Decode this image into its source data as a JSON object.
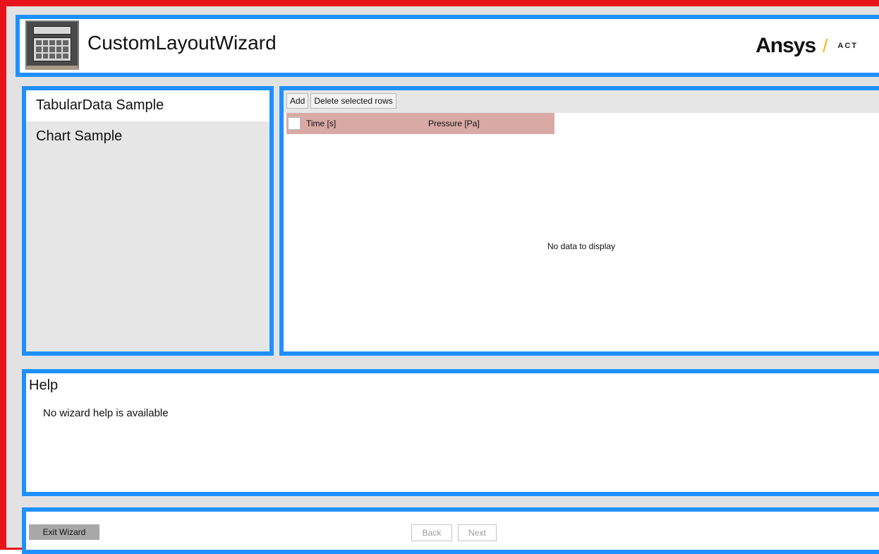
{
  "header": {
    "title": "CustomLayoutWizard",
    "brand": "Ansys",
    "brand_suffix": "ACT"
  },
  "nav": {
    "items": [
      {
        "label": "TabularData Sample",
        "selected": true
      },
      {
        "label": "Chart Sample",
        "selected": false
      }
    ]
  },
  "toolbar": {
    "add_label": "Add",
    "delete_label": "Delete selected rows"
  },
  "table": {
    "columns": [
      "Time [s]",
      "Pressure [Pa]"
    ],
    "rows": [],
    "empty_message": "No data to display",
    "header_color": "#d9a9a6"
  },
  "help": {
    "title": "Help",
    "text": "No wizard help is available"
  },
  "footer": {
    "exit_label": "Exit Wizard",
    "back_label": "Back",
    "next_label": "Next"
  },
  "colors": {
    "accent_border": "#1e90ff",
    "frame": "#e8141b",
    "brand_slash": "#f6b600"
  }
}
